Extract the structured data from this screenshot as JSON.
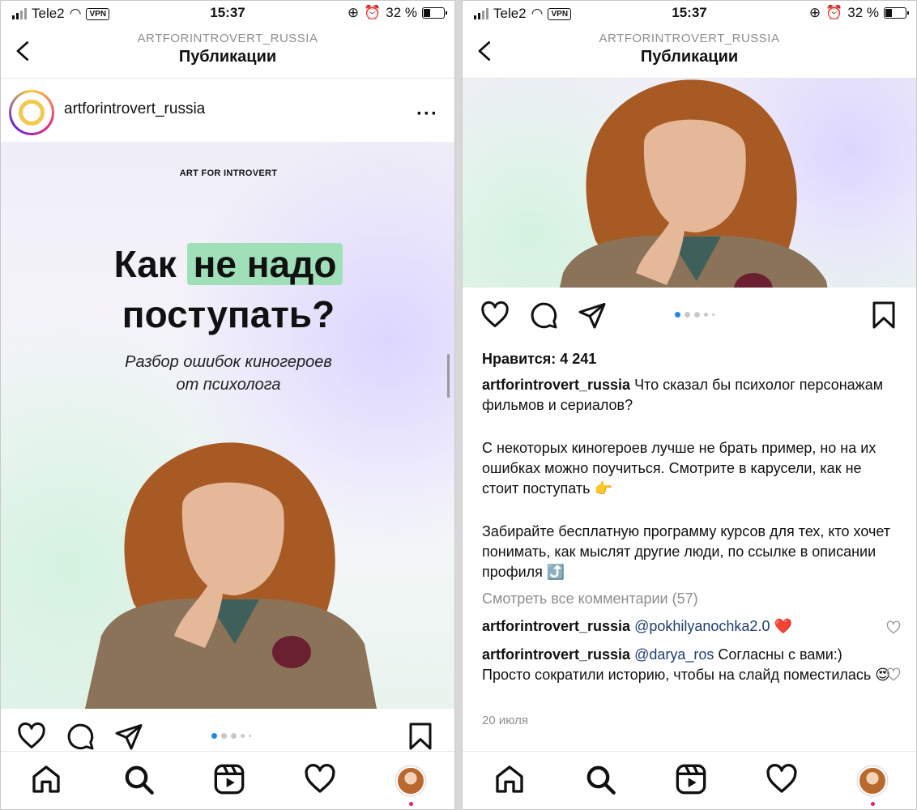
{
  "status_bar": {
    "carrier": "Tele2",
    "vpn": "VPN",
    "time": "15:37",
    "battery": "32 %"
  },
  "nav": {
    "account": "ARTFORINTROVERT_RUSSIA",
    "title": "Публикации"
  },
  "post": {
    "username": "artforintrovert_russia",
    "more_label": "···",
    "slide": {
      "brand": "ART FOR INTROVERT",
      "headline_1": "Как ",
      "headline_highlight": "не надо",
      "headline_2": "поступать?",
      "subtitle_1": "Разбор ошибок киногероев",
      "subtitle_2": "от психолога"
    },
    "carousel": {
      "count": 5,
      "active": 1
    },
    "likes": "Нравится: 4 241",
    "caption_user": "artforintrovert_russia",
    "caption_p1": "Что сказал бы психолог персонажам фильмов и сериалов?",
    "caption_p2": "С некоторых киногероев лучше не брать пример, но на их ошибках можно поучиться. Смотрите в карусели, как не стоит поступать 👉",
    "caption_p3": "Забирайте бесплатную программу курсов для тех, кто хочет понимать, как мыслят другие люди, по ссылке в описании профиля ⤴️",
    "view_comments": "Смотреть все комментарии (57)",
    "comments": [
      {
        "user": "artforintrovert_russia",
        "mention": "@pokhilyanochka2.0",
        "text": " ❤️"
      },
      {
        "user": "artforintrovert_russia",
        "mention": "@darya_ros",
        "text": " Согласны с вами:) Просто сократили историю, чтобы на слайд поместилась 😍"
      }
    ],
    "date": "20 июля"
  },
  "colors": {
    "highlight": "#9fe0b8",
    "active_dot": "#1e88e5",
    "notification": "#e0245e",
    "link": "#1e3e6e"
  },
  "icons": [
    "back-chevron-icon",
    "like-heart-icon",
    "comment-icon",
    "share-icon",
    "save-bookmark-icon",
    "home-icon",
    "search-icon",
    "reels-icon",
    "activity-heart-icon"
  ]
}
